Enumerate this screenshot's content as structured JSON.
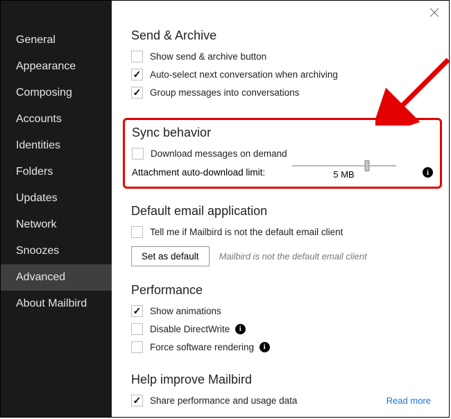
{
  "sidebar": {
    "items": [
      {
        "label": "General"
      },
      {
        "label": "Appearance"
      },
      {
        "label": "Composing"
      },
      {
        "label": "Accounts"
      },
      {
        "label": "Identities"
      },
      {
        "label": "Folders"
      },
      {
        "label": "Updates"
      },
      {
        "label": "Network"
      },
      {
        "label": "Snoozes"
      },
      {
        "label": "Advanced",
        "active": true
      },
      {
        "label": "About Mailbird"
      }
    ]
  },
  "sections": {
    "send_archive": {
      "title": "Send & Archive",
      "opt1": "Show send & archive button",
      "opt2": "Auto-select next conversation when archiving",
      "opt3": "Group messages into conversations"
    },
    "sync": {
      "title": "Sync behavior",
      "opt1": "Download messages on demand",
      "slider_label": "Attachment auto-download limit:",
      "slider_value": "5 MB",
      "slider_pct": 72
    },
    "default_app": {
      "title": "Default email application",
      "opt1": "Tell me if Mailbird is not the default email client",
      "button": "Set as default",
      "status": "Mailbird is not the default email client"
    },
    "performance": {
      "title": "Performance",
      "opt1": "Show animations",
      "opt2": "Disable DirectWrite",
      "opt3": "Force software rendering"
    },
    "help": {
      "title": "Help improve Mailbird",
      "opt1": "Share performance and usage data",
      "link": "Read more"
    }
  },
  "colors": {
    "highlight": "#e30000"
  }
}
